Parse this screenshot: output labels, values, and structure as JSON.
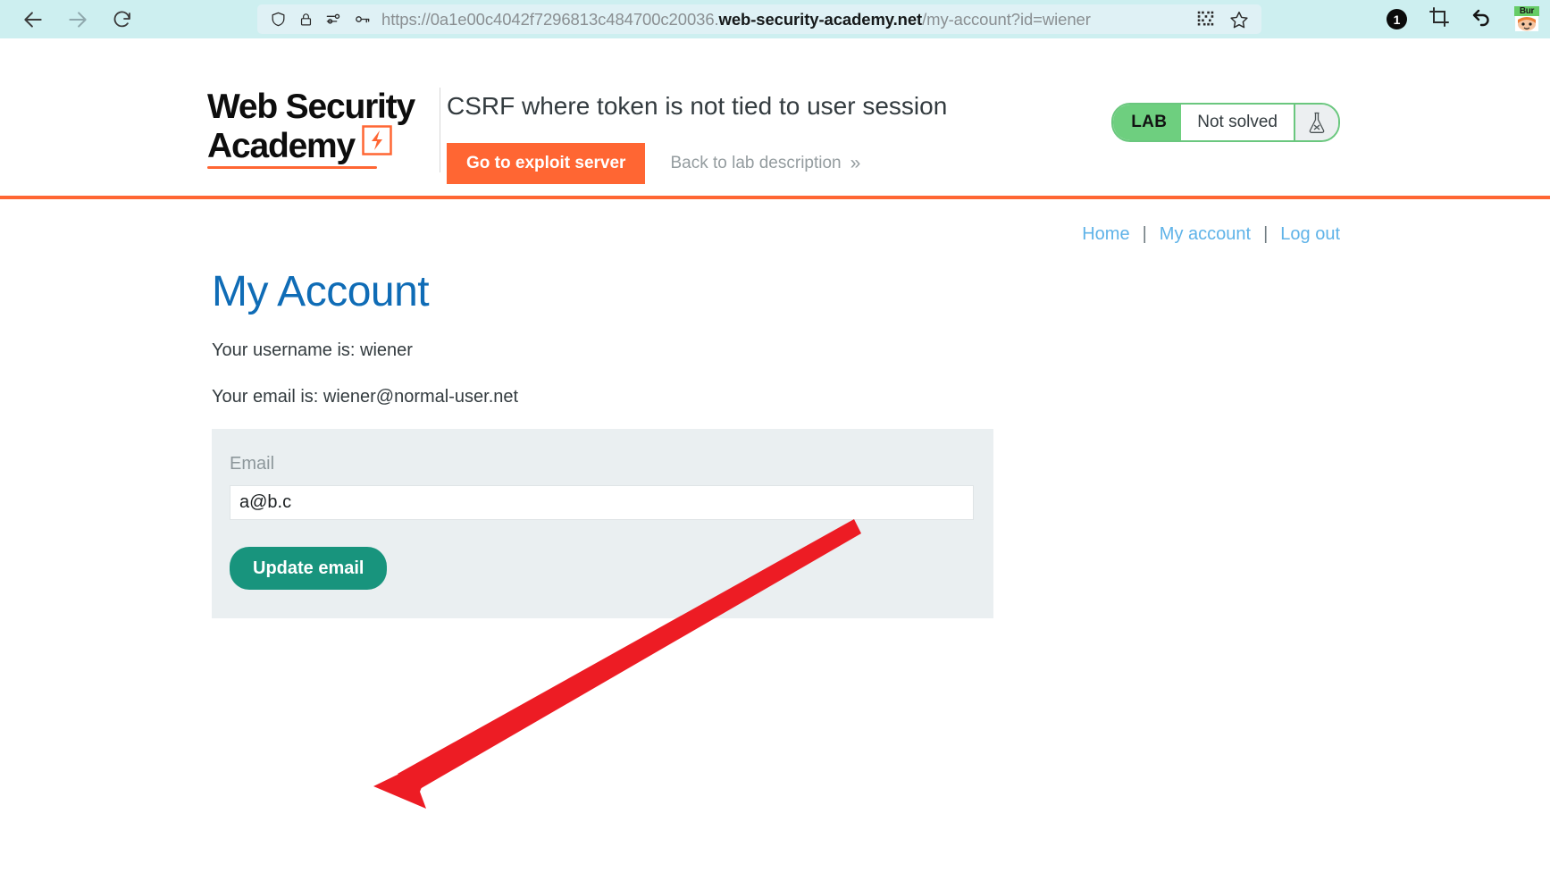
{
  "browser": {
    "back_icon": "arrow-left-icon",
    "forward_icon": "arrow-right-icon",
    "reload_icon": "reload-icon",
    "shield_icon": "shield-icon",
    "lock_icon": "padlock-icon",
    "permissions_icon": "site-settings-icon",
    "key_icon": "key-icon",
    "qr_icon": "qr-code-icon",
    "bookmark_icon": "star-icon",
    "url_prefix": "https://0a1e00c4042f7296813c484700c20036.",
    "url_host": "web-security-academy.net",
    "url_path": "/my-account?id=wiener",
    "extension_badge_count": "1",
    "screenshot_icon": "crop-icon",
    "undo_icon": "undo-arrow-icon",
    "burp_extension_label": "Bur"
  },
  "header": {
    "logo_line1": "Web Security",
    "logo_line2": "Academy",
    "logo_mark_icon": "lightning-bolt-icon",
    "lab_title": "CSRF where token is not tied to user session",
    "exploit_button": "Go to exploit server",
    "back_to_lab": "Back to lab description",
    "back_chevron": "»",
    "lab_tag": "LAB",
    "lab_state": "Not solved",
    "lab_flask_icon": "flask-not-solved-icon"
  },
  "account_nav": {
    "home": "Home",
    "my_account": "My account",
    "log_out": "Log out",
    "separator": "|"
  },
  "main": {
    "page_title": "My Account",
    "username_line": "Your username is: wiener",
    "email_line": "Your email is: wiener@normal-user.net",
    "form": {
      "email_label": "Email",
      "email_value": "a@b.c",
      "email_placeholder": "",
      "submit_label": "Update email"
    }
  },
  "annotation": {
    "arrow_icon": "red-arrow-annotation",
    "color": "#ed1c24"
  },
  "colors": {
    "brand_orange": "#ff6633",
    "title_blue": "#0f6cb6",
    "link_blue": "#5fb3e8",
    "lab_green": "#6ecf7f",
    "button_teal": "#18947d",
    "panel_grey": "#eaeff1",
    "chrome_bg": "#cdeff0"
  }
}
